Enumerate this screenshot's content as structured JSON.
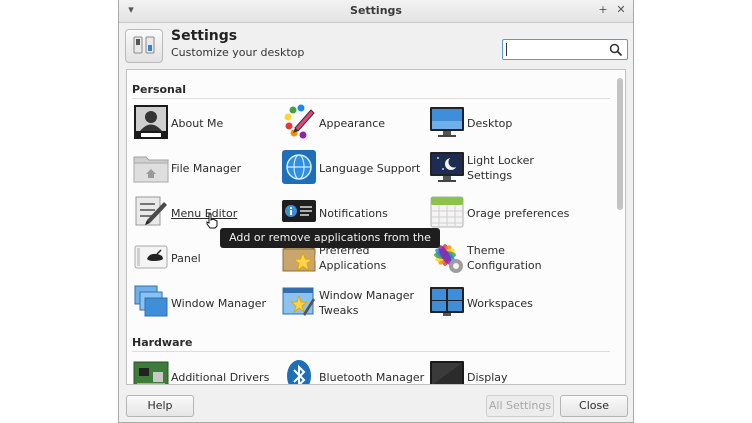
{
  "window": {
    "title": "Settings"
  },
  "header": {
    "title": "Settings",
    "subtitle": "Customize your desktop"
  },
  "search": {
    "value": "",
    "placeholder": ""
  },
  "sections": {
    "personal": {
      "title": "Personal",
      "items": [
        {
          "label": "About Me",
          "icon": "user-id-card-icon"
        },
        {
          "label": "Appearance",
          "icon": "palette-icon"
        },
        {
          "label": "Desktop",
          "icon": "monitor-icon"
        },
        {
          "label": "File Manager",
          "icon": "folder-home-icon"
        },
        {
          "label": "Language Support",
          "icon": "globe-icon"
        },
        {
          "label": "Light Locker Settings",
          "icon": "moon-screen-icon"
        },
        {
          "label": "Menu Editor",
          "icon": "menu-editor-icon"
        },
        {
          "label": "Notifications",
          "icon": "info-notification-icon"
        },
        {
          "label": "Orage preferences",
          "icon": "calendar-icon"
        },
        {
          "label": "Panel",
          "icon": "panel-mouse-icon"
        },
        {
          "label": "Preferred Applications",
          "icon": "star-box-icon"
        },
        {
          "label": "Theme Configuration",
          "icon": "theme-gear-icon"
        },
        {
          "label": "Window Manager",
          "icon": "window-manager-icon"
        },
        {
          "label": "Window Manager Tweaks",
          "icon": "window-tweaks-icon"
        },
        {
          "label": "Workspaces",
          "icon": "workspaces-icon"
        }
      ]
    },
    "hardware": {
      "title": "Hardware",
      "items": [
        {
          "label": "Additional Drivers",
          "icon": "circuit-board-icon"
        },
        {
          "label": "Bluetooth Manager",
          "icon": "bluetooth-icon"
        },
        {
          "label": "Display",
          "icon": "display-icon"
        }
      ]
    }
  },
  "tooltip": {
    "text": "Add or remove applications from the menu"
  },
  "buttons": {
    "help": "Help",
    "all_settings": "All Settings",
    "close": "Close"
  },
  "colors": {
    "accent": "#5b9bd5",
    "tooltip_bg": "#1e1e1e"
  }
}
